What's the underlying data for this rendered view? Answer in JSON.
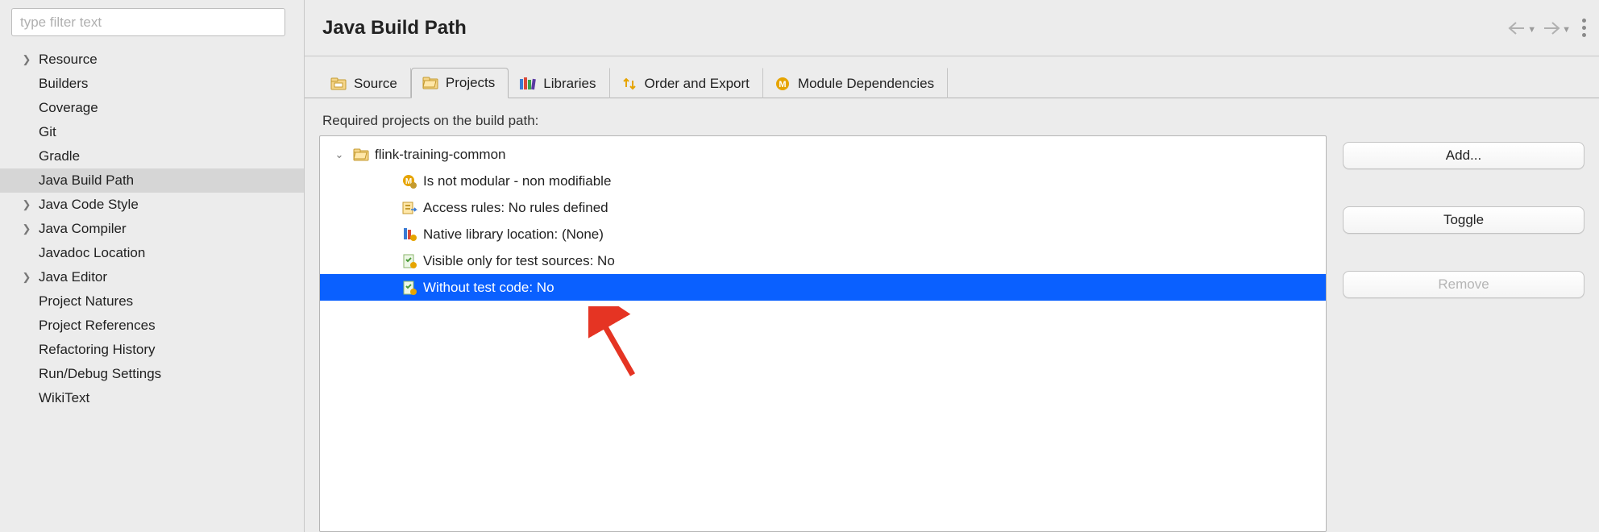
{
  "filter": {
    "placeholder": "type filter text",
    "value": ""
  },
  "sidebar": {
    "items": [
      {
        "label": "Resource",
        "expandable": true
      },
      {
        "label": "Builders",
        "expandable": false
      },
      {
        "label": "Coverage",
        "expandable": false
      },
      {
        "label": "Git",
        "expandable": false
      },
      {
        "label": "Gradle",
        "expandable": false
      },
      {
        "label": "Java Build Path",
        "expandable": false,
        "selected": true
      },
      {
        "label": "Java Code Style",
        "expandable": true
      },
      {
        "label": "Java Compiler",
        "expandable": true
      },
      {
        "label": "Javadoc Location",
        "expandable": false
      },
      {
        "label": "Java Editor",
        "expandable": true
      },
      {
        "label": "Project Natures",
        "expandable": false
      },
      {
        "label": "Project References",
        "expandable": false
      },
      {
        "label": "Refactoring History",
        "expandable": false
      },
      {
        "label": "Run/Debug Settings",
        "expandable": false
      },
      {
        "label": "WikiText",
        "expandable": false
      }
    ]
  },
  "header": {
    "title": "Java Build Path"
  },
  "tabs": [
    {
      "label": "Source",
      "icon": "source-icon"
    },
    {
      "label": "Projects",
      "icon": "projects-icon",
      "active": true
    },
    {
      "label": "Libraries",
      "icon": "libraries-icon"
    },
    {
      "label": "Order and Export",
      "icon": "order-export-icon"
    },
    {
      "label": "Module Dependencies",
      "icon": "module-deps-icon"
    }
  ],
  "panel": {
    "caption": "Required projects on the build path:",
    "root": {
      "label": "flink-training-common",
      "expanded": true
    },
    "children": [
      {
        "label": "Is not modular - non modifiable",
        "icon": "module-attr-icon"
      },
      {
        "label": "Access rules: No rules defined",
        "icon": "access-rules-icon"
      },
      {
        "label": "Native library location: (None)",
        "icon": "native-lib-icon"
      },
      {
        "label": "Visible only for test sources: No",
        "icon": "test-visibility-icon"
      },
      {
        "label": "Without test code: No",
        "icon": "test-code-icon",
        "selected": true
      }
    ]
  },
  "buttons": {
    "add": "Add...",
    "toggle": "Toggle",
    "remove": "Remove"
  }
}
